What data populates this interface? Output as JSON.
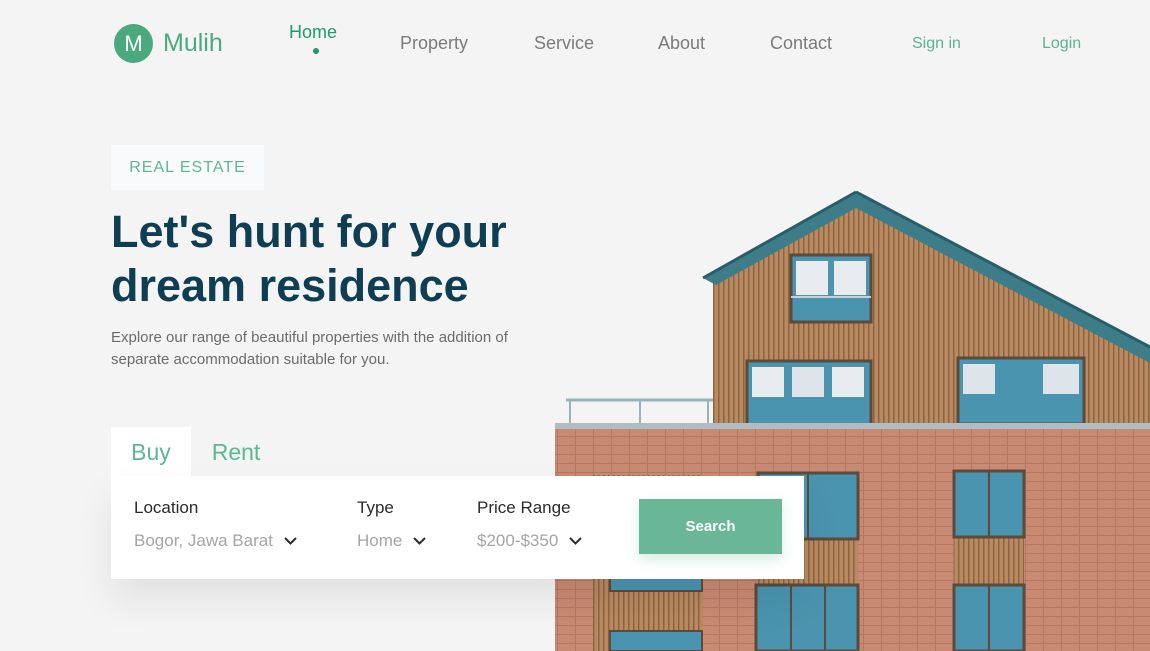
{
  "brand": {
    "mark": "M",
    "name": "Mulih",
    "color": "#4ba97e"
  },
  "nav": {
    "items": [
      {
        "label": "Home",
        "active": true
      },
      {
        "label": "Property",
        "active": false
      },
      {
        "label": "Service",
        "active": false
      },
      {
        "label": "About",
        "active": false
      },
      {
        "label": "Contact",
        "active": false
      }
    ],
    "sign_in": "Sign in",
    "login": "Login"
  },
  "hero": {
    "badge": "REAL ESTATE",
    "headline": "Let's hunt for your dream residence",
    "subtext": "Explore our range of beautiful properties with the addition of separate accommodation suitable for you."
  },
  "search": {
    "tabs": [
      {
        "label": "Buy",
        "selected": true
      },
      {
        "label": "Rent",
        "selected": false
      }
    ],
    "fields": [
      {
        "label": "Location",
        "value": "Bogor, Jawa Barat"
      },
      {
        "label": "Type",
        "value": "Home"
      },
      {
        "label": "Price Range",
        "value": "$200-$350"
      }
    ],
    "button_label": "Search"
  },
  "colors": {
    "accent": "#69b796",
    "heading": "#0f3e52",
    "active_nav": "#1f9a6b"
  }
}
